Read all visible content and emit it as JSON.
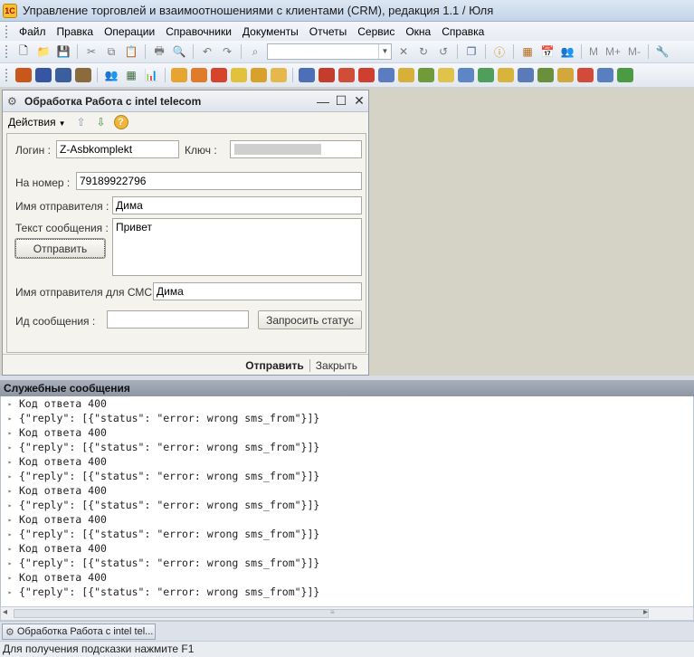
{
  "app": {
    "title": "Управление торговлей и взаимоотношениями с клиентами (CRM), редакция 1.1 / Юля",
    "icon": "1c-logo-icon"
  },
  "menu": [
    {
      "label": "Файл"
    },
    {
      "label": "Правка"
    },
    {
      "label": "Операции"
    },
    {
      "label": "Справочники"
    },
    {
      "label": "Документы"
    },
    {
      "label": "Отчеты"
    },
    {
      "label": "Сервис"
    },
    {
      "label": "Окна"
    },
    {
      "label": "Справка"
    }
  ],
  "toolbar1": {
    "mem_buttons": [
      "M",
      "M+",
      "M-"
    ]
  },
  "dialog": {
    "title": "Обработка  Работа с intel telecom",
    "actions_label": "Действия",
    "fields": {
      "login_label": "Логин :",
      "login_value": "Z-Asbkomplekt",
      "key_label": "Ключ :",
      "key_value": "",
      "number_label": "На номер :",
      "number_value": "79189922796",
      "sender_label": "Имя отправителя :",
      "sender_value": "Дима",
      "text_label": "Текст сообщения :",
      "text_value": "Привет",
      "sms_sender_label": "Имя отправителя для СМС :",
      "sms_sender_value": "Дима",
      "msg_id_label": "Ид сообщения :",
      "msg_id_value": ""
    },
    "buttons": {
      "send": "Отправить",
      "request_status": "Запросить статус"
    },
    "footer": {
      "send": "Отправить",
      "close": "Закрыть"
    }
  },
  "messages": {
    "header": "Служебные сообщения",
    "rows": [
      "Код ответа 400",
      "{\"reply\": [{\"status\": \"error: wrong sms_from\"}]}",
      "Код ответа 400",
      "{\"reply\": [{\"status\": \"error: wrong sms_from\"}]}",
      "Код ответа 400",
      "{\"reply\": [{\"status\": \"error: wrong sms_from\"}]}",
      "Код ответа 400",
      "{\"reply\": [{\"status\": \"error: wrong sms_from\"}]}",
      "Код ответа 400",
      "{\"reply\": [{\"status\": \"error: wrong sms_from\"}]}",
      "Код ответа 400",
      "{\"reply\": [{\"status\": \"error: wrong sms_from\"}]}",
      "Код ответа 400",
      "{\"reply\": [{\"status\": \"error: wrong sms_from\"}]}"
    ]
  },
  "taskbar": {
    "item_label": "Обработка  Работа с intel tel..."
  },
  "status": {
    "hint": "Для получения подсказки нажмите F1"
  },
  "colors": {
    "workspace_bg": "#d5d3c5",
    "dialog_bg": "#f4f3ee",
    "message_header_bg": "#9aa2ae"
  }
}
